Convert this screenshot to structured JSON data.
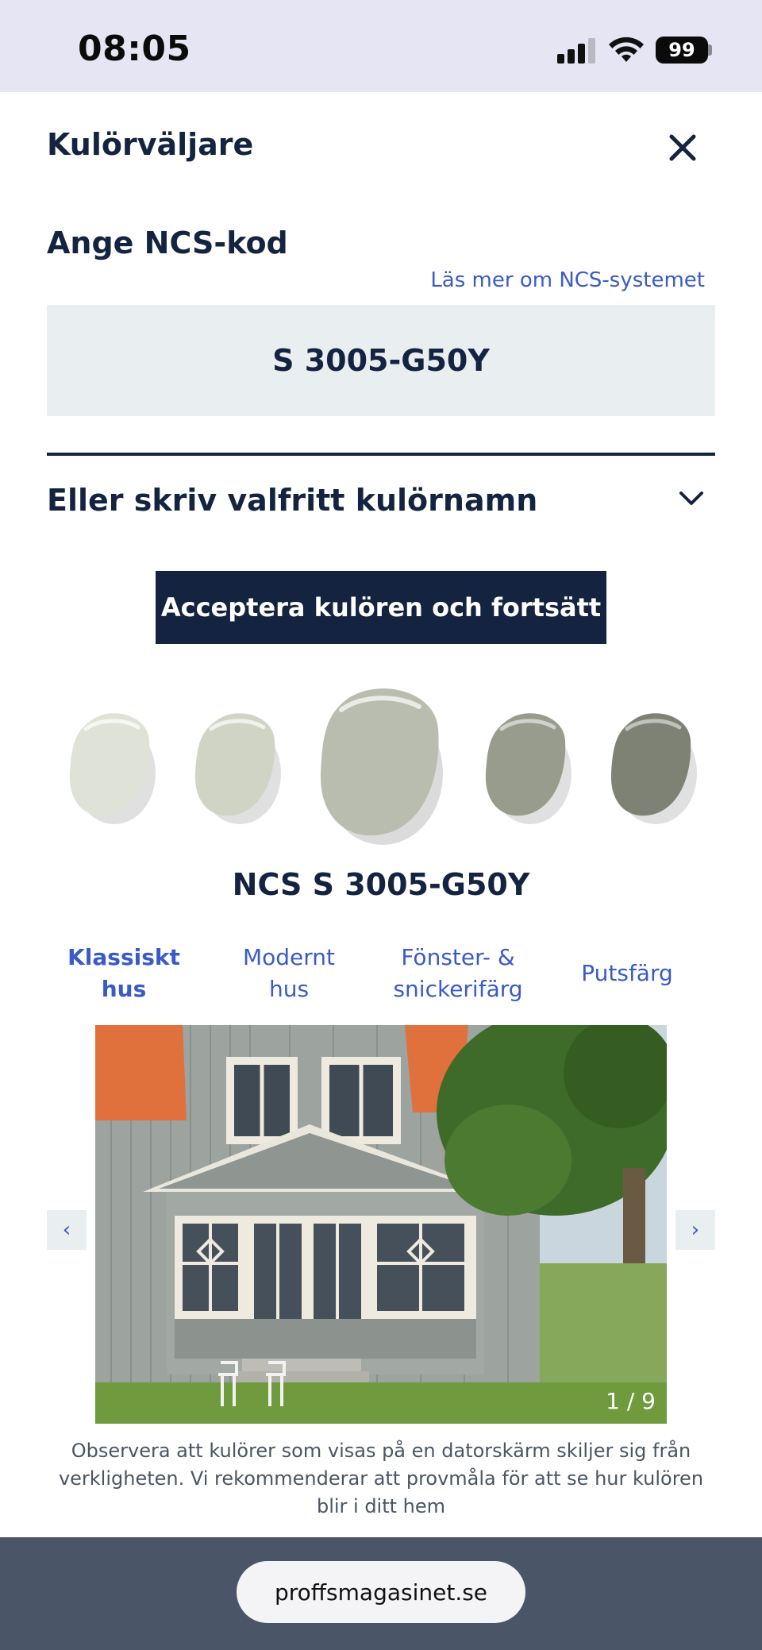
{
  "status_bar": {
    "time": "08:05",
    "battery": "99"
  },
  "modal": {
    "title": "Kulörväljare",
    "ncs_heading": "Ange NCS-kod",
    "ncs_link": "Läs mer om NCS-systemet",
    "ncs_value": "S 3005-G50Y",
    "name_dropdown_label": "Eller skriv valfritt kulörnamn",
    "accept_button": "Acceptera kulören och fortsätt",
    "color_name": "NCS S 3005-G50Y",
    "swatch_colors": [
      "#dfe2d6",
      "#d0d4c5",
      "#b9bdaf",
      "#979c8d",
      "#7e8275"
    ],
    "tabs": [
      {
        "label_line1": "Klassiskt",
        "label_line2": "hus",
        "active": true
      },
      {
        "label_line1": "Modernt",
        "label_line2": "hus",
        "active": false
      },
      {
        "label_line1": "Fönster- &",
        "label_line2": "snickerifärg",
        "active": false
      },
      {
        "label_line1": "Putsfärg",
        "label_line2": "",
        "active": false
      }
    ],
    "gallery": {
      "counter": "1 / 9",
      "prev": "‹",
      "next": "›"
    },
    "disclaimer": "Observera att kulörer som visas på en datorskärm skiljer sig från verkligheten. Vi rekommenderar att provmåla för att se hur kulören blir i ditt hem"
  },
  "browser": {
    "url": "proffsmagasinet.se"
  }
}
